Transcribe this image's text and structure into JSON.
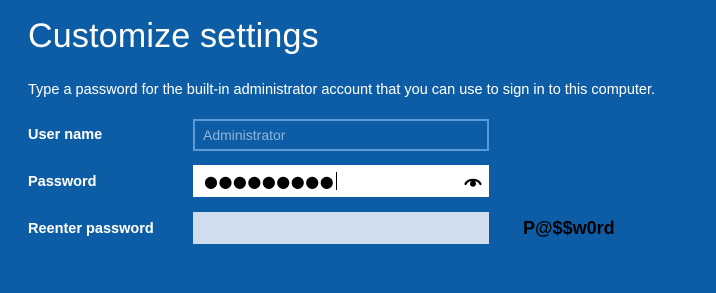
{
  "header": {
    "title": "Customize settings"
  },
  "description": "Type a password for the built-in administrator account that you can use to sign in to this computer.",
  "form": {
    "username": {
      "label": "User name",
      "placeholder": "Administrator",
      "value": ""
    },
    "password": {
      "label": "Password",
      "masked_value": "●●●●●●●●●",
      "reveal_icon": "eye-icon"
    },
    "reenter_password": {
      "label": "Reenter password",
      "value": ""
    }
  },
  "annotation": "P@$$w0rd",
  "colors": {
    "background": "#0d5da6",
    "text": "#ffffff",
    "disabled_field_border": "#5b9ad4",
    "inactive_field_fill": "#cfdded"
  }
}
